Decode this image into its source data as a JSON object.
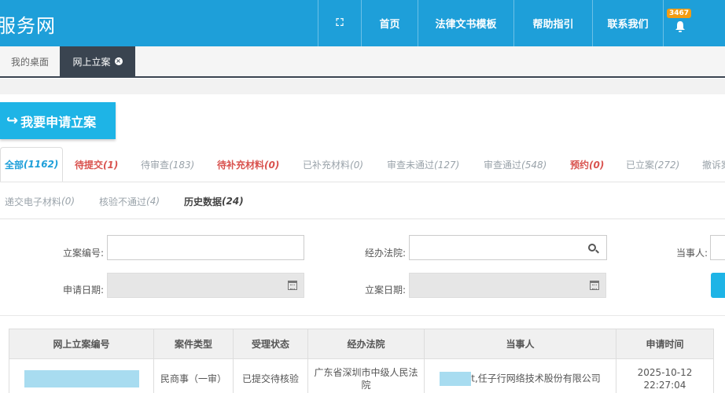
{
  "header": {
    "brand": "服务网",
    "nav": [
      {
        "key": "fullscreen",
        "label": "⛶"
      },
      {
        "key": "home",
        "label": "首页"
      },
      {
        "key": "templates",
        "label": "法律文书模板"
      },
      {
        "key": "help",
        "label": "帮助指引"
      },
      {
        "key": "contact",
        "label": "联系我们"
      }
    ],
    "notification_count": "3467",
    "accent": "#1e9fd9"
  },
  "tabs": {
    "desk": "我的桌面",
    "active": "网上立案"
  },
  "apply_button": "我要申请立案",
  "filters": {
    "all": {
      "label": "全部",
      "count": "(1162)"
    },
    "pending_submit": {
      "label": "待提交",
      "count": "(1)"
    },
    "pending_review": {
      "label": "待审查",
      "count": "(183)"
    },
    "pending_supplement": {
      "label": "待补充材料",
      "count": "(0)"
    },
    "supplemented": {
      "label": "已补充材料",
      "count": "(0)"
    },
    "review_failed": {
      "label": "审查未通过",
      "count": "(127)"
    },
    "review_passed": {
      "label": "审查通过",
      "count": "(548)"
    },
    "appointment": {
      "label": "预约",
      "count": "(0)"
    },
    "filed": {
      "label": "已立案",
      "count": "(272)"
    },
    "withdrawn": {
      "label": "撤诉案"
    },
    "e_materials": {
      "label": "递交电子材料",
      "count": "(0)"
    },
    "verify_failed": {
      "label": "核验不通过",
      "count": "(4)"
    },
    "history": {
      "label": "历史数据",
      "count": "(24)"
    }
  },
  "search": {
    "case_no_label": "立案编号:",
    "court_label": "经办法院:",
    "party_label": "当事人:",
    "apply_date_label": "申请日期:",
    "file_date_label": "立案日期:"
  },
  "table": {
    "columns": [
      "网上立案编号",
      "案件类型",
      "受理状态",
      "经办法院",
      "当事人",
      "申请时间"
    ],
    "rows": [
      {
        "case_type": "民商事（一审）",
        "status": "已提交待核验",
        "court": "广东省深圳市中级人民法院",
        "party_suffix": "t,任子行网络技术股份有限公司",
        "time": "2025-10-12 22:27:04"
      }
    ]
  }
}
